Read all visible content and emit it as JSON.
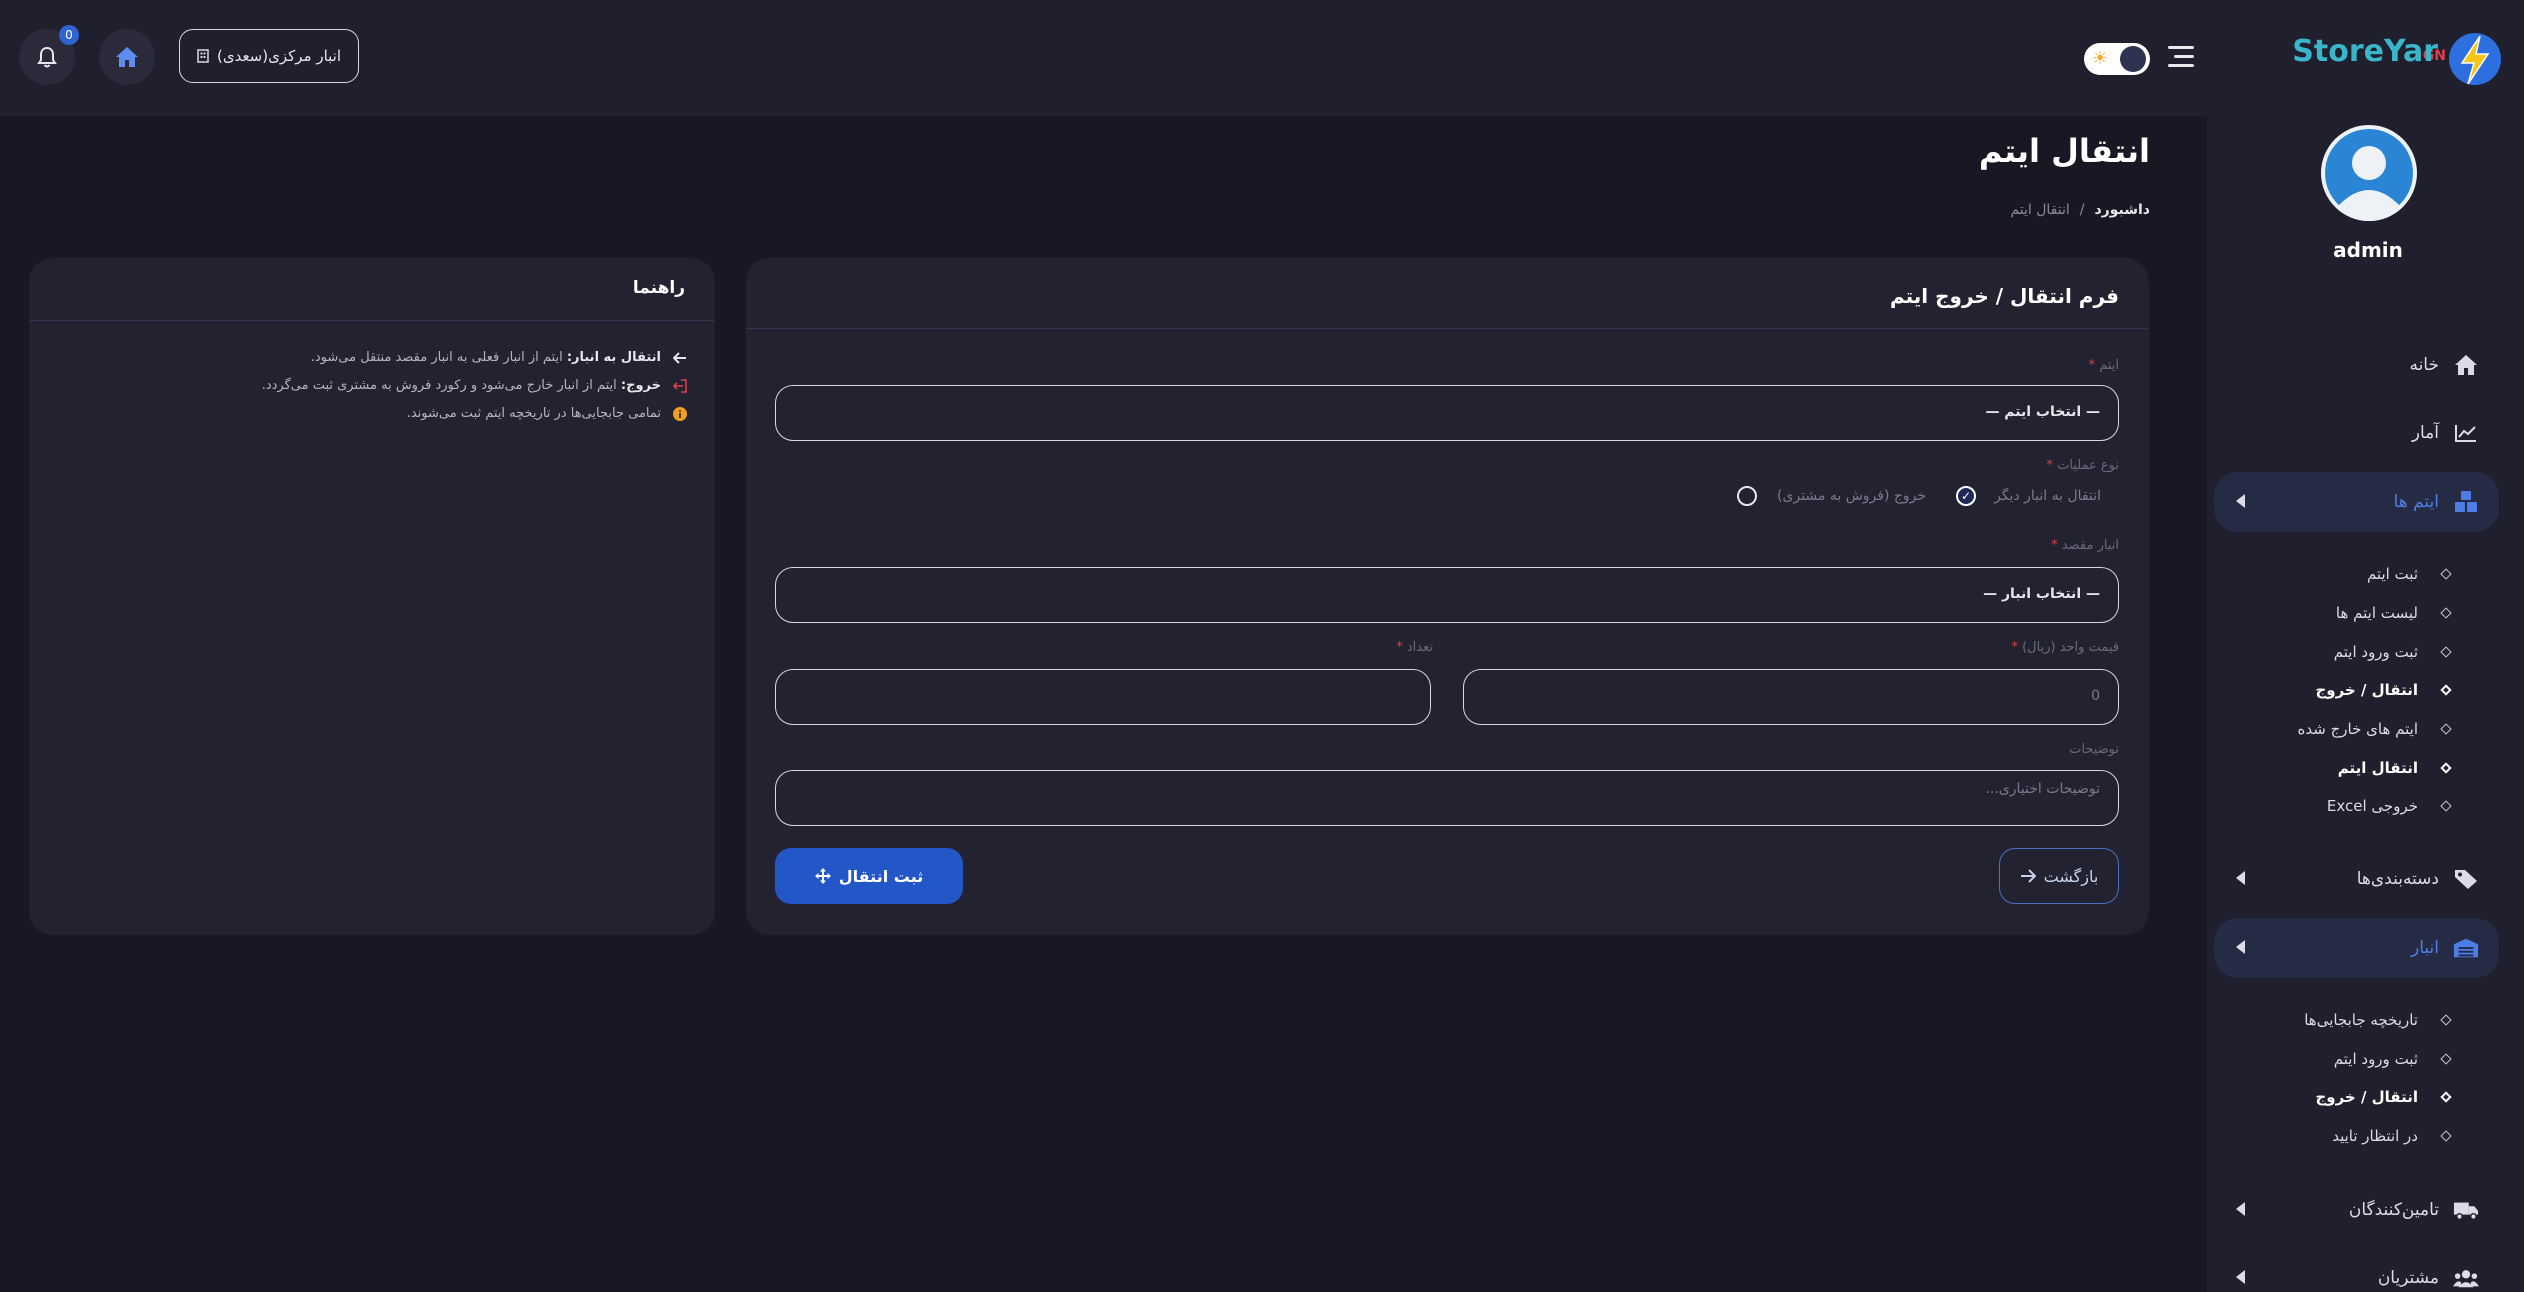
{
  "brand": {
    "name": "StoreYar",
    "suffix": "GN"
  },
  "user": {
    "name": "admin"
  },
  "topbar": {
    "store_label": "انبار مرکزی(سعدی)",
    "notif_count": "0"
  },
  "sidebar": {
    "items": [
      {
        "label": "خانه",
        "icon": "home-icon"
      },
      {
        "label": "آمار",
        "icon": "chart-icon"
      },
      {
        "label": "ایتم ها",
        "icon": "boxes-icon"
      },
      {
        "label": "دسته‌بندی‌ها",
        "icon": "tags-icon"
      },
      {
        "label": "انبار",
        "icon": "warehouse-icon"
      },
      {
        "label": "تامین‌کنندگان",
        "icon": "truck-icon"
      },
      {
        "label": "مشتریان",
        "icon": "users-icon"
      }
    ],
    "items_sub": [
      "ثبت ایتم",
      "لیست ایتم ها",
      "ثبت ورود ایتم",
      "انتقال / خروج",
      "ایتم های خارج شده",
      "انتقال ایتم",
      "خروجی Excel"
    ],
    "warehouse_sub": [
      "تاریخچه جابجایی‌ها",
      "ثبت ورود ایتم",
      "انتقال / خروج",
      "در انتظار تایید"
    ]
  },
  "page": {
    "title": "انتقال ایتم",
    "breadcrumb_home": "داشبورد",
    "breadcrumb_sep": "/",
    "breadcrumb_current": "انتقال ایتم"
  },
  "form": {
    "title": "فرم انتقال / خروج ایتم",
    "item_label": "ایتم",
    "item_value": "— انتخاب ایتم —",
    "op_label": "نوع عملیات",
    "op_options": [
      "انتقال به انبار دیگر",
      "خروج (فروش به مشتری)"
    ],
    "dest_label": "انبار مقصد",
    "dest_value": "— انتخاب انبار —",
    "price_label": "قیمت واحد (ریال)",
    "price_placeholder": "0",
    "qty_label": "تعداد",
    "qty_value": "",
    "desc_label": "توضیحات",
    "desc_placeholder": "توضیحات اختیاری...",
    "required_mark": "*",
    "back_label": "بازگشت",
    "submit_label": "ثبت انتقال"
  },
  "guide": {
    "title": "راهنما",
    "lines": [
      {
        "bold": "انتقال به انبار:",
        "text": " ایتم از انبار فعلی به انبار مقصد منتقل می‌شود."
      },
      {
        "bold": "خروج:",
        "text": " ایتم از انبار خارج می‌شود و رکورد فروش به مشتری ثبت می‌گردد."
      },
      {
        "bold": "",
        "text": "تمامی جابجایی‌ها در تاریخچه ایتم ثبت می‌شوند."
      }
    ]
  },
  "colors": {
    "accent": "#2356c6",
    "brand": "#39b6c9",
    "required": "#e53d49",
    "background": "#181825",
    "card": "#222230"
  }
}
